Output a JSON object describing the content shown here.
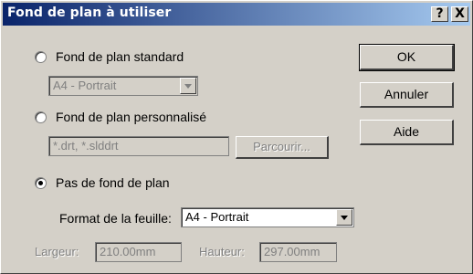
{
  "window": {
    "title": "Fond de plan à utiliser",
    "help_label": "?",
    "close_label": "X"
  },
  "options": {
    "standard": {
      "label": "Fond de plan standard",
      "value": "A4 - Portrait"
    },
    "custom": {
      "label": "Fond de plan personnalisé",
      "placeholder": "*.drt, *.slddrt",
      "browse_label": "Parcourir..."
    },
    "none": {
      "label": "Pas de fond de plan"
    }
  },
  "sheet_format": {
    "label": "Format de la feuille:",
    "value": "A4 - Portrait"
  },
  "width": {
    "label": "Largeur:",
    "value": "210.00mm"
  },
  "height": {
    "label": "Hauteur:",
    "value": "297.00mm"
  },
  "buttons": {
    "ok": "OK",
    "cancel": "Annuler",
    "help": "Aide"
  }
}
